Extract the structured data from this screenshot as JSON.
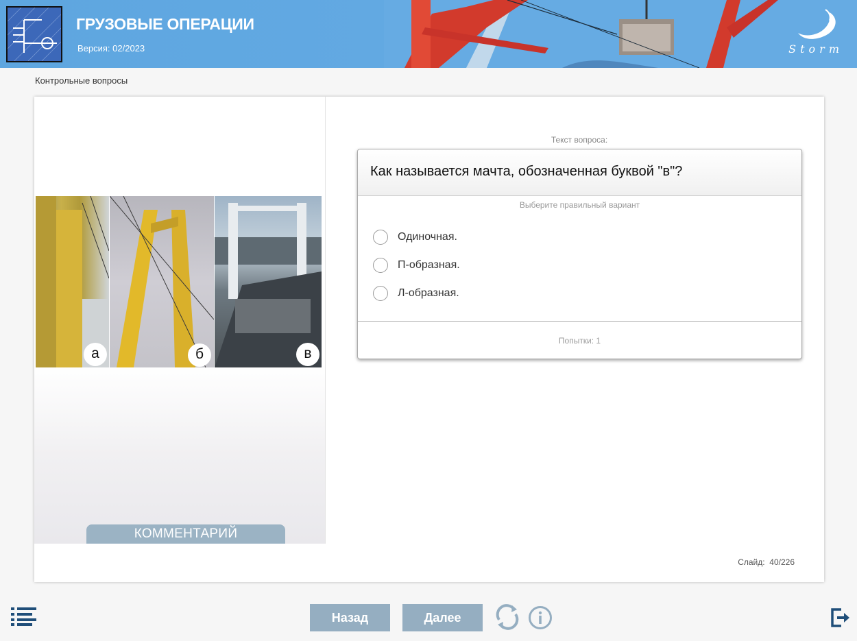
{
  "header": {
    "title": "ГРУЗОВЫЕ ОПЕРАЦИИ",
    "version": "Версия: 02/2023",
    "brand": "Storm",
    "logo_icon": "course-logo-icon",
    "colors": {
      "header_bg": "#62a9e2",
      "accent": "#95aec1"
    }
  },
  "breadcrumb": "Контрольные вопросы",
  "media": {
    "labels": [
      "а",
      "б",
      "в"
    ],
    "comment_button": "КОММЕНТАРИЙ"
  },
  "question": {
    "caption": "Текст вопроса:",
    "text": "Как называется мачта, обозначенная буквой \"в\"?",
    "instruction": "Выберите правильный вариант",
    "options": [
      {
        "label": "Одиночная.",
        "selected": false
      },
      {
        "label": "П-образная.",
        "selected": false
      },
      {
        "label": "Л-образная.",
        "selected": false
      }
    ],
    "attempts": "Попытки: 1"
  },
  "slide": {
    "label": "Слайд:",
    "current": "40",
    "total": "226"
  },
  "toolbar": {
    "back_label": "Назад",
    "next_label": "Далее",
    "icons": [
      "menu-icon",
      "reload-icon",
      "info-icon",
      "exit-icon"
    ]
  }
}
